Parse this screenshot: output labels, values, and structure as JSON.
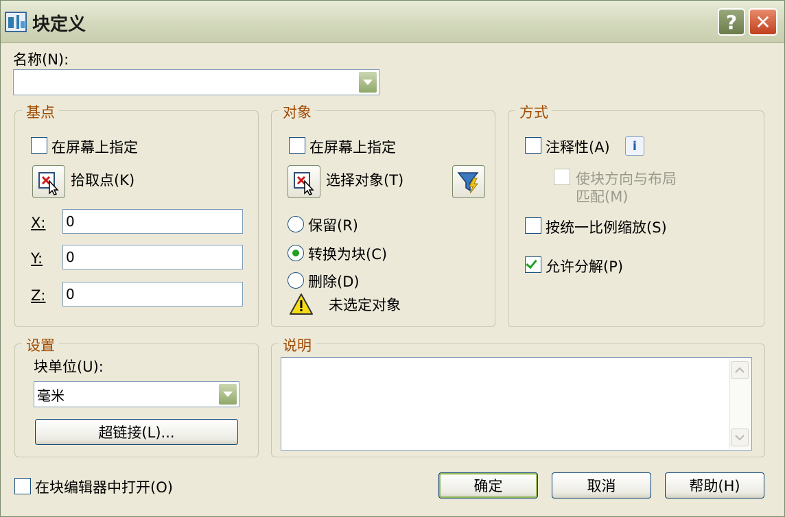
{
  "window": {
    "title": "块定义",
    "help_label": "?",
    "close_label": "✕"
  },
  "name": {
    "label": "名称(N):",
    "value": ""
  },
  "base_point": {
    "title": "基点",
    "specify_on_screen": "在屏幕上指定",
    "pick_point": "拾取点(K)",
    "x_label": "X:",
    "x_value": "0",
    "y_label": "Y:",
    "y_value": "0",
    "z_label": "Z:",
    "z_value": "0"
  },
  "objects": {
    "title": "对象",
    "specify_on_screen": "在屏幕上指定",
    "select_objects": "选择对象(T)",
    "retain": "保留(R)",
    "convert_to_block": "转换为块(C)",
    "delete": "删除(D)",
    "warning": "未选定对象",
    "selected": "convert_to_block"
  },
  "behavior": {
    "title": "方式",
    "annotative": "注释性(A)",
    "info_label": "i",
    "match_orientation_line1": "使块方向与布局",
    "match_orientation_line2": "匹配(M)",
    "scale_uniformly": "按统一比例缩放(S)",
    "allow_exploding": "允许分解(P)"
  },
  "settings": {
    "title": "设置",
    "block_unit_label": "块单位(U):",
    "block_unit_value": "毫米",
    "hyperlink": "超链接(L)..."
  },
  "description": {
    "title": "说明",
    "value": ""
  },
  "open_in_editor": "在块编辑器中打开(O)",
  "buttons": {
    "ok": "确定",
    "cancel": "取消",
    "help": "帮助(H)"
  }
}
